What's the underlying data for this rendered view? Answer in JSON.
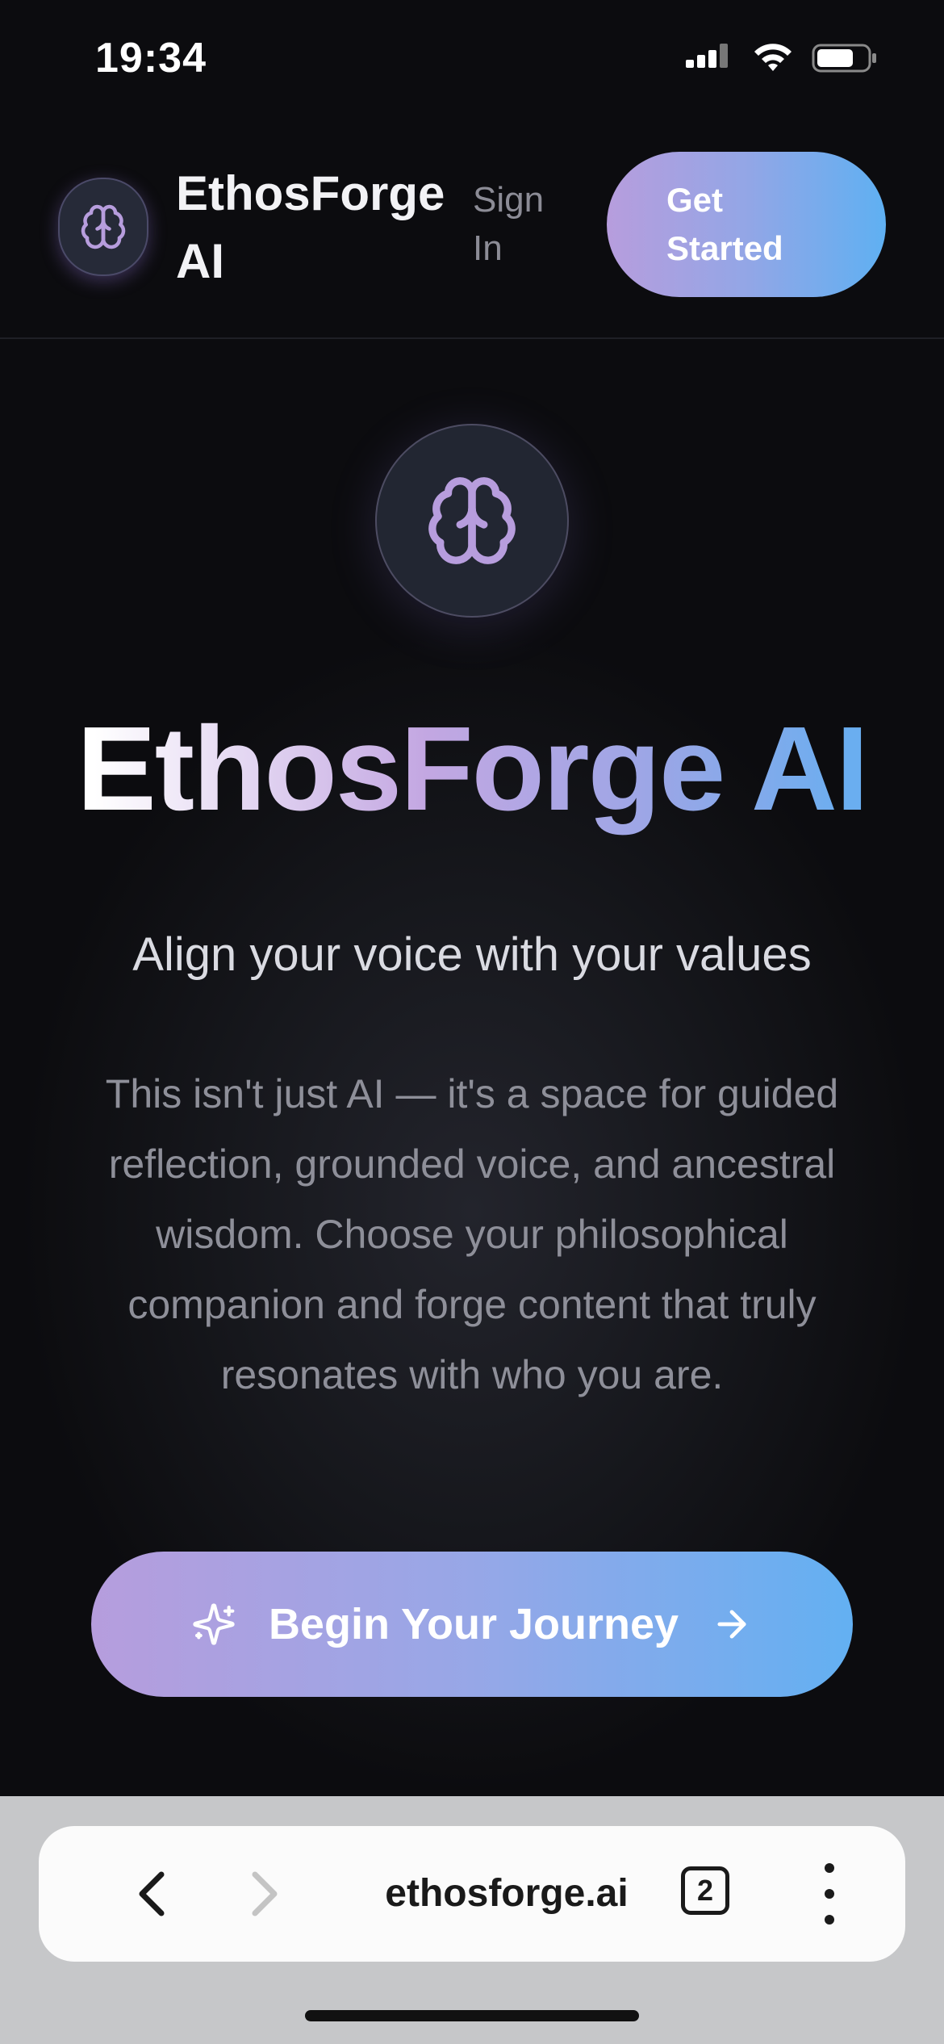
{
  "status_bar": {
    "time": "19:34",
    "icons": [
      "cellular-signal-icon",
      "wifi-icon",
      "battery-icon"
    ]
  },
  "header": {
    "logo_icon": "brain-icon",
    "brand_name": "EthosForge AI",
    "sign_in_label": "Sign In",
    "get_started_label": "Get Started"
  },
  "hero": {
    "icon": "brain-icon",
    "title_part1": "EthosForge",
    "title_part2": "AI",
    "tagline": "Align your voice with your values",
    "description": "This isn't just AI — it's a space for guided reflection, grounded voice, and ancestral wisdom. Choose your philosophical companion and forge content that truly resonates with who you are.",
    "cta_label": "Begin Your Journey",
    "cta_icons": [
      "sparkles-icon",
      "arrow-right-icon"
    ]
  },
  "browser": {
    "url": "ethosforge.ai",
    "tab_count": "2",
    "icons": [
      "back-icon",
      "forward-icon",
      "more-icon"
    ]
  },
  "colors": {
    "accent_purple": "#b79ddd",
    "accent_blue": "#5fb0f2",
    "background": "#0c0c0f"
  }
}
